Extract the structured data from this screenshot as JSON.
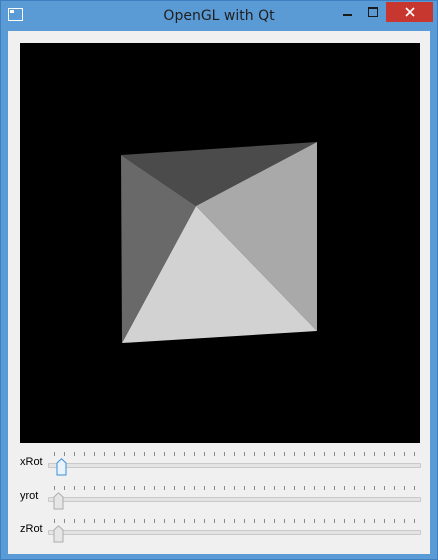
{
  "window": {
    "title": "OpenGL with Qt",
    "controls": {
      "minimize": "minimize-icon",
      "maximize": "maximize-icon",
      "close": "close-icon"
    }
  },
  "colors": {
    "titlebar": "#5b9bd5",
    "close_button": "#c7372f",
    "client_background": "#f0f0f0",
    "viewport_background": "#000000",
    "active_handle": "#3b8ed8"
  },
  "viewport": {
    "background": "black",
    "content": "shaded pyramid"
  },
  "sliders": [
    {
      "label": "xRot",
      "value_fraction": 0.0,
      "active": true
    },
    {
      "label": "yrot",
      "value_fraction": 0.0,
      "active": false
    },
    {
      "label": "zRot",
      "value_fraction": 0.0,
      "active": false
    }
  ]
}
